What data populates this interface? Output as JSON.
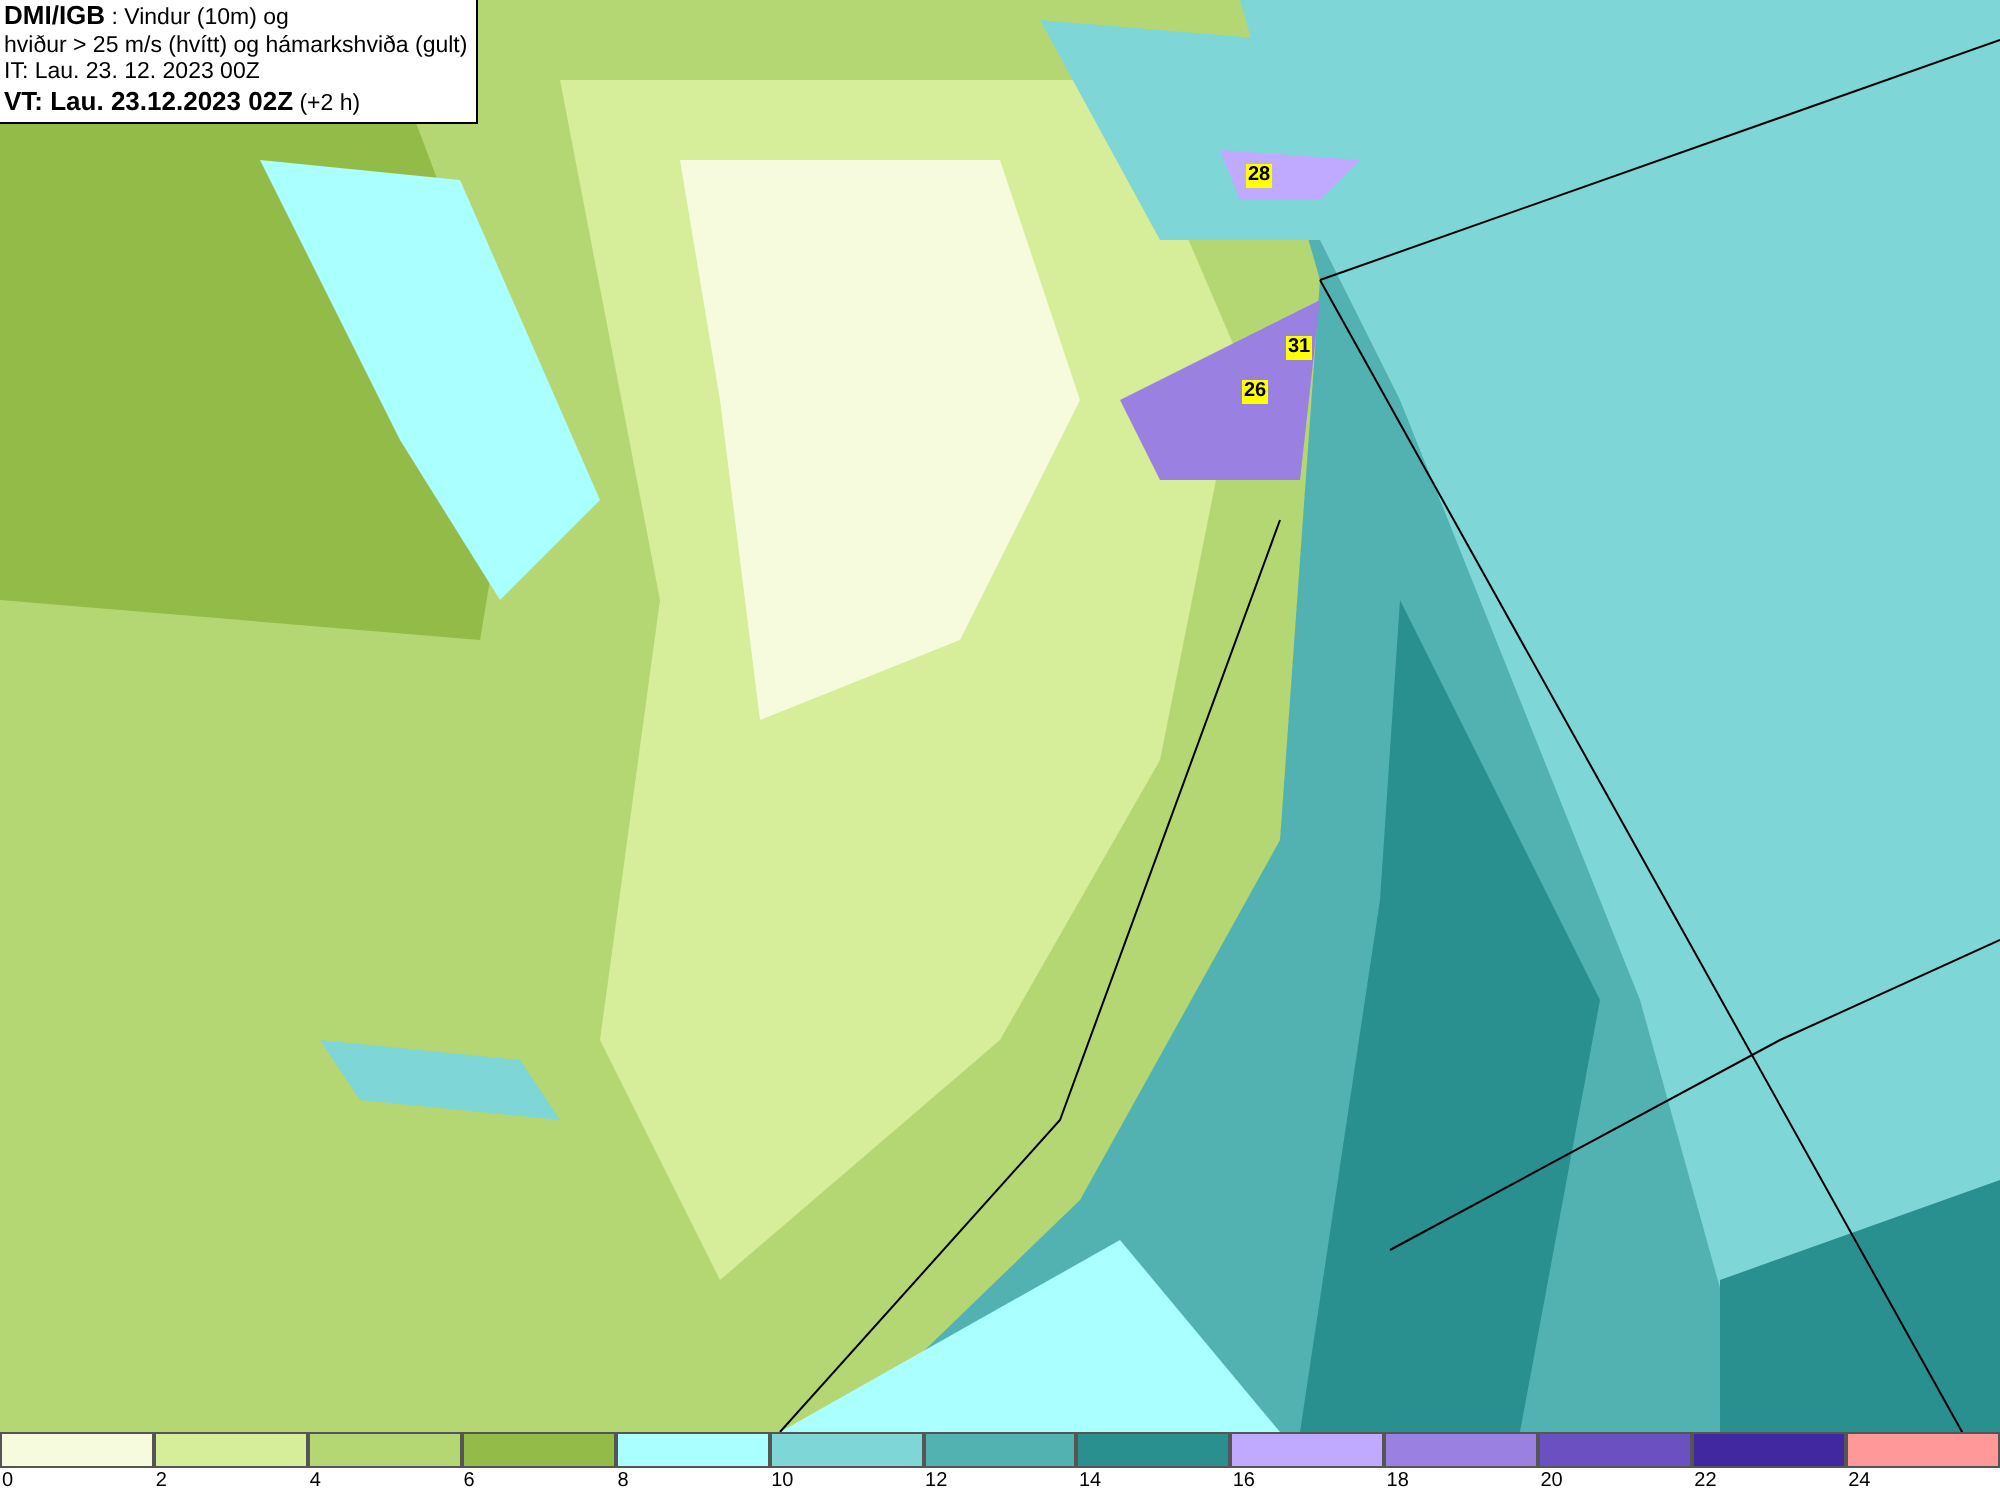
{
  "header": {
    "lines": [
      "**DMI/IGB** : Vindur (10m) og",
      "hviður > 25 m/s (hvítt) og hámarkshviða (gult)",
      "IT: Lau. 23. 12. 2023 00Z",
      "**VT: Lau. 23.12.2023 02Z** (+2 h)"
    ]
  },
  "map": {
    "gust_labels": [
      "28",
      "31",
      "26"
    ]
  },
  "legend": [
    {
      "label": "0",
      "color": "#f5fbdc"
    },
    {
      "label": "2",
      "color": "#d6ed9a"
    },
    {
      "label": "4",
      "color": "#b4d774"
    },
    {
      "label": "6",
      "color": "#93bb47"
    },
    {
      "label": "8",
      "color": "#aaffff"
    },
    {
      "label": "10",
      "color": "#7fd6d6"
    },
    {
      "label": "12",
      "color": "#52b2b2"
    },
    {
      "label": "14",
      "color": "#2a8f8f"
    },
    {
      "label": "16",
      "color": "#c0aaff"
    },
    {
      "label": "18",
      "color": "#9a80e0"
    },
    {
      "label": "20",
      "color": "#6a50c0"
    },
    {
      "label": "22",
      "color": "#4228a0"
    },
    {
      "label": "24",
      "color": "#ff9999"
    }
  ]
}
